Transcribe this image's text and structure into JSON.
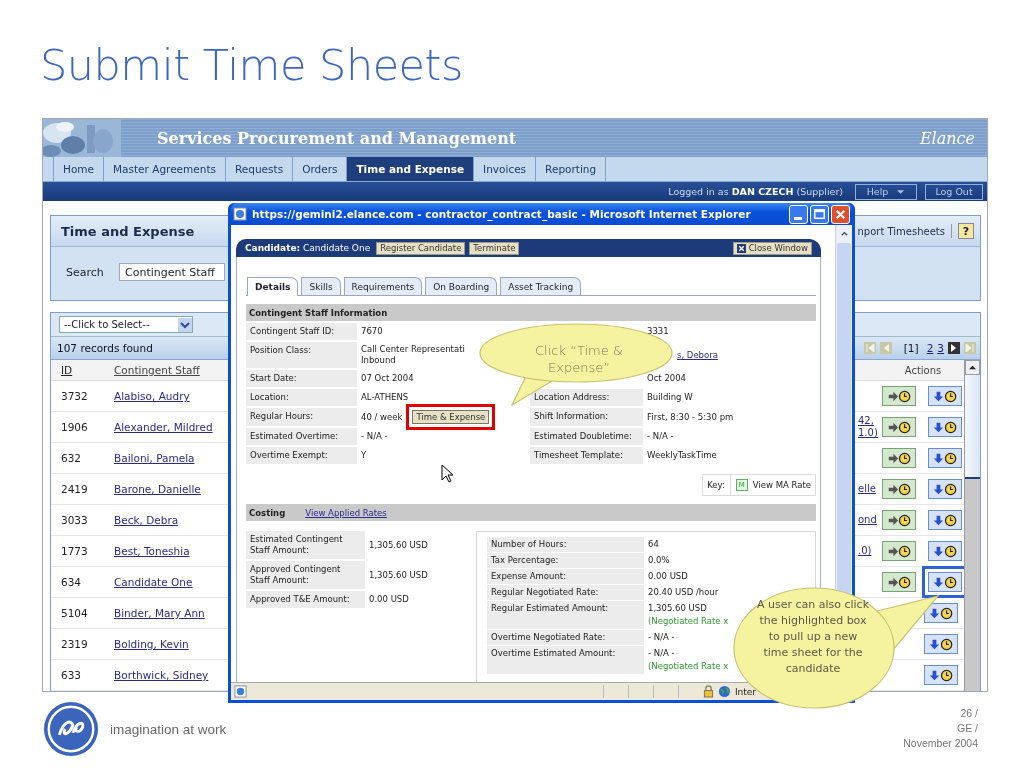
{
  "slide": {
    "title": "Submit Time Sheets",
    "tagline": "imagination at work",
    "page": "26 /",
    "company": "GE /",
    "date": "November 2004"
  },
  "app": {
    "title": "Services Procurement and Management",
    "logo": "Elance",
    "nav": [
      {
        "label": "Home",
        "selected": false
      },
      {
        "label": "Master Agreements",
        "selected": false
      },
      {
        "label": "Requests",
        "selected": false
      },
      {
        "label": "Orders",
        "selected": false
      },
      {
        "label": "Time and Expense",
        "selected": true
      },
      {
        "label": "Invoices",
        "selected": false
      },
      {
        "label": "Reporting",
        "selected": false
      }
    ],
    "user_bar": {
      "prefix": "Logged in as",
      "user": "DAN CZECH",
      "role": "(Supplier)",
      "help": "Help",
      "logout": "Log Out"
    },
    "panel": {
      "title": "Time and Expense",
      "search_label": "Search",
      "search_value": "Contingent Staff",
      "import_link": "nport Timesheets",
      "help": "?"
    },
    "filter": "--Click to Select--",
    "records": "107 records found",
    "pager": {
      "pages": [
        {
          "label": "[1]",
          "selected": true
        },
        {
          "label": "2",
          "selected": false
        },
        {
          "label": "3",
          "selected": false
        }
      ],
      "buttons": [
        {
          "kind": "first",
          "disabled": true
        },
        {
          "kind": "prev",
          "disabled": true
        },
        {
          "kind": "next",
          "disabled": false
        },
        {
          "kind": "last",
          "disabled": true
        }
      ]
    },
    "table": {
      "columns": [
        "ID",
        "Contingent Staff"
      ],
      "actions_header": "Actions",
      "rows": [
        {
          "id": "3732",
          "name": "Alabiso, Audry",
          "actions": [
            {
              "kind": "start",
              "highlighted": false
            },
            {
              "kind": "new",
              "highlighted": false
            }
          ]
        },
        {
          "id": "1906",
          "name": "Alexander, Mildred",
          "column_3": [
            "42,",
            "1.0)"
          ],
          "actions": [
            {
              "kind": "start",
              "highlighted": false
            },
            {
              "kind": "new",
              "highlighted": false
            }
          ]
        },
        {
          "id": "632",
          "name": "Bailoni, Pamela",
          "actions": [
            {
              "kind": "start",
              "highlighted": false
            },
            {
              "kind": "new",
              "highlighted": false
            }
          ]
        },
        {
          "id": "2419",
          "name": "Barone, Danielle",
          "column_3": [
            "elle"
          ],
          "actions": [
            {
              "kind": "start",
              "highlighted": false
            },
            {
              "kind": "new",
              "highlighted": false
            }
          ]
        },
        {
          "id": "3033",
          "name": "Beck, Debra",
          "column_3": [
            "ond"
          ],
          "actions": [
            {
              "kind": "start",
              "highlighted": false
            },
            {
              "kind": "new",
              "highlighted": false
            }
          ]
        },
        {
          "id": "1773",
          "name": "Best, Toneshia",
          "column_3": [
            ".0)"
          ],
          "actions": [
            {
              "kind": "start",
              "highlighted": false
            },
            {
              "kind": "new",
              "highlighted": false
            }
          ]
        },
        {
          "id": "634",
          "name": "Candidate One",
          "actions": [
            {
              "kind": "start",
              "highlighted": false
            },
            {
              "kind": "new",
              "highlighted": true
            }
          ]
        },
        {
          "id": "5104",
          "name": "Binder, Mary Ann",
          "actions": [
            {
              "kind": "new",
              "highlighted": false
            }
          ]
        },
        {
          "id": "2319",
          "name": "Bolding, Kevin",
          "actions": [
            {
              "kind": "new",
              "highlighted": false
            }
          ]
        },
        {
          "id": "633",
          "name": "Borthwick, Sidney",
          "actions": [
            {
              "kind": "new",
              "highlighted": false
            }
          ]
        }
      ]
    }
  },
  "popup": {
    "title": "https://gemini2.elance.com - contractor_contract_basic - Microsoft Internet Explorer",
    "candidate_label": "Candidate:",
    "candidate": "Candidate One",
    "actions": [
      "Register Candidate",
      "Terminate"
    ],
    "close": "Close Window",
    "tabs": [
      {
        "label": "Details",
        "selected": true
      },
      {
        "label": "Skills",
        "selected": false
      },
      {
        "label": "Requirements",
        "selected": false
      },
      {
        "label": "On Boarding",
        "selected": false
      },
      {
        "label": "Asset Tracking",
        "selected": false
      }
    ],
    "info_title": "Contingent Staff Information",
    "info_rows": [
      {
        "left": {
          "label": "Contingent Staff ID:",
          "value": "7670",
          "kind": "text"
        },
        "right": {
          "value": "3331",
          "kind": "text"
        }
      },
      {
        "left": {
          "label": "Position Class:",
          "value": [
            "Call Center Representati",
            "Inbound"
          ],
          "kind": "text"
        },
        "right": {
          "value": "s, Debora",
          "kind": "link"
        }
      },
      {
        "left": {
          "label": "Start Date:",
          "value": "07 Oct 2004",
          "kind": "text"
        },
        "right": {
          "value": "Oct 2004",
          "kind": "text"
        }
      },
      {
        "left": {
          "label": "Location:",
          "value": "AL-ATHENS",
          "kind": "text"
        },
        "right": {
          "label": "Location Address:",
          "value": "Building W",
          "kind": "text"
        }
      },
      {
        "left": {
          "label": "Regular Hours:",
          "value": "40 / week",
          "kind": "button",
          "button": "Time & Expense",
          "highlighted": true
        },
        "right": {
          "label": "Shift Information:",
          "value": "First, 8:30 - 5:30 pm",
          "kind": "text"
        }
      },
      {
        "left": {
          "label": "Estimated Overtime:",
          "value": "- N/A -",
          "kind": "text"
        },
        "right": {
          "label": "Estimated Doubletime:",
          "value": "- N/A -",
          "kind": "text"
        }
      },
      {
        "left": {
          "label": "Overtime Exempt:",
          "value": "Y",
          "kind": "text"
        },
        "right": {
          "label": "Timesheet Template:",
          "value": "WeeklyTaskTime",
          "kind": "text"
        }
      }
    ],
    "key": {
      "label": "Key:",
      "icon": "M",
      "text": "View MA Rate"
    },
    "costing": {
      "title": "Costing",
      "link": "View Applied Rates",
      "left": [
        {
          "label": "Estimated Contingent Staff Amount:",
          "value": "1,305.60 USD"
        },
        {
          "label": "Approved Contingent Staff Amount:",
          "value": "1,305.60 USD"
        },
        {
          "label": "Approved T&E Amount:",
          "value": "0.00 USD"
        }
      ],
      "right": [
        {
          "label": "Number of Hours:",
          "value": "64"
        },
        {
          "label": "Tax Percentage:",
          "value": "0.0%"
        },
        {
          "label": "Expense Amount:",
          "value": "0.00 USD"
        },
        {
          "label": "Regular Negotiated Rate:",
          "value": "20.40 USD /hour"
        },
        {
          "label": "Regular Estimated Amount:",
          "value": "1,305.60 USD",
          "note": "(Negotiated Rate x"
        },
        {
          "label": "Overtime Negotiated Rate:",
          "value": "- N/A -"
        },
        {
          "label": "Overtime Estimated Amount:",
          "value": "- N/A -",
          "note": "(Negotiated Rate x"
        }
      ]
    },
    "status": "Inter"
  },
  "callouts": [
    {
      "text": "Click “Time & Expense”"
    },
    {
      "text": "A user can also click the highlighted box to pull up a new time sheet for the candidate"
    }
  ]
}
